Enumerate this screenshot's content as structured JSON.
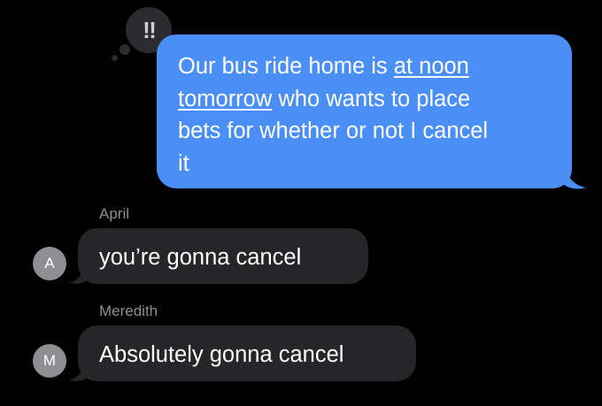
{
  "tapback": {
    "glyph": "‼",
    "icon": "double-exclamation-icon"
  },
  "outgoing_message": {
    "line1_pre": "Our bus ride home is ",
    "link1": "at noon",
    "link2": "tomorrow",
    "line2_post": " who wants to place",
    "line3": "bets for whether or not I cancel",
    "line4": "it",
    "color": "#4a8ff7"
  },
  "messages": [
    {
      "sender": "April",
      "avatar_initial": "A",
      "text": "you’re gonna cancel"
    },
    {
      "sender": "Meredith",
      "avatar_initial": "M",
      "text": "Absolutely gonna cancel"
    }
  ],
  "colors": {
    "incoming_bubble": "#262629",
    "avatar": "#8e8e93",
    "background": "#000000"
  }
}
